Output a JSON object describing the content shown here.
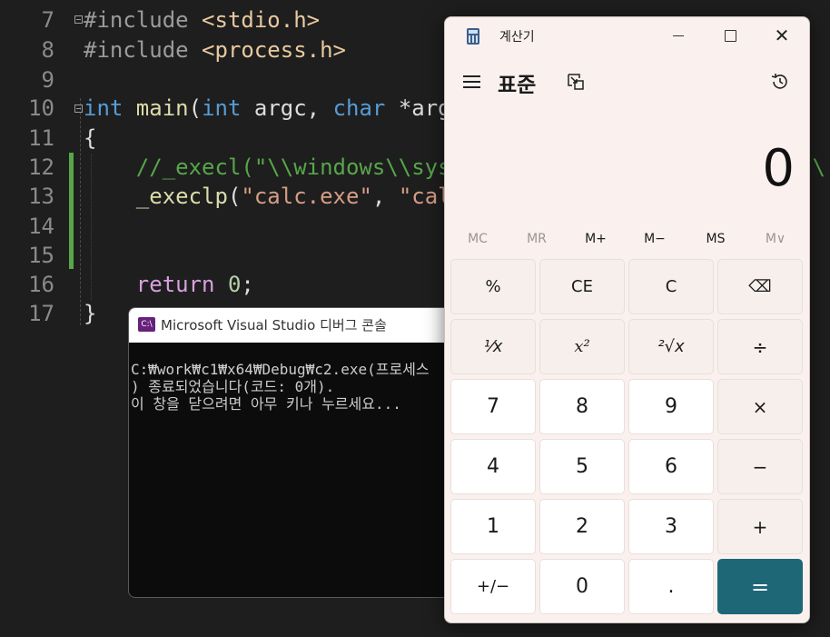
{
  "editor": {
    "lines": [
      {
        "num": "7"
      },
      {
        "num": "8"
      },
      {
        "num": "9"
      },
      {
        "num": "10"
      },
      {
        "num": "11"
      },
      {
        "num": "12"
      },
      {
        "num": "13"
      },
      {
        "num": "14"
      },
      {
        "num": "15"
      },
      {
        "num": "16"
      },
      {
        "num": "17"
      }
    ],
    "tokens": {
      "l7_pp": "#include ",
      "l7_inc": "<stdio.h>",
      "l8_pp": "#include ",
      "l8_inc": "<process.h>",
      "l10_int": "int",
      "l10_main": " main",
      "l10_p1": "(",
      "l10_int2": "int",
      "l10_argc": " argc, ",
      "l10_char": "char",
      "l10_argv": " *arg",
      "l11_brace": "{",
      "l12_comment": "    //_execl(\"\\\\windows\\\\sys",
      "l12_tail": "s\\",
      "l13_fn": "    _execlp",
      "l13_p": "(",
      "l13_str1": "\"calc.exe\"",
      "l13_comma": ", ",
      "l13_str2": "\"cal",
      "l16_return": "    return",
      "l16_num": " 0",
      "l16_semi": ";",
      "l17_brace": "}"
    }
  },
  "console": {
    "title": "Microsoft Visual Studio 디버그 콘솔",
    "icon_label": "C:\\",
    "lines": [
      "C:₩work₩c1₩x64₩Debug₩c2.exe(프로세스",
      ") 종료되었습니다(코드: 0개).",
      "이 창을 닫으려면 아무 키나 누르세요..."
    ]
  },
  "calculator": {
    "title": "계산기",
    "mode": "표준",
    "display": "0",
    "memory": [
      "MC",
      "MR",
      "M+",
      "M−",
      "MS",
      "M∨"
    ],
    "keys": [
      "%",
      "CE",
      "C",
      "⌫",
      "⅟x",
      "x²",
      "²√x",
      "÷",
      "7",
      "8",
      "9",
      "×",
      "4",
      "5",
      "6",
      "−",
      "1",
      "2",
      "3",
      "+",
      "+/−",
      "0",
      ".",
      "="
    ],
    "colors": {
      "accent": "#1e6777",
      "background": "#faf1ee"
    }
  }
}
